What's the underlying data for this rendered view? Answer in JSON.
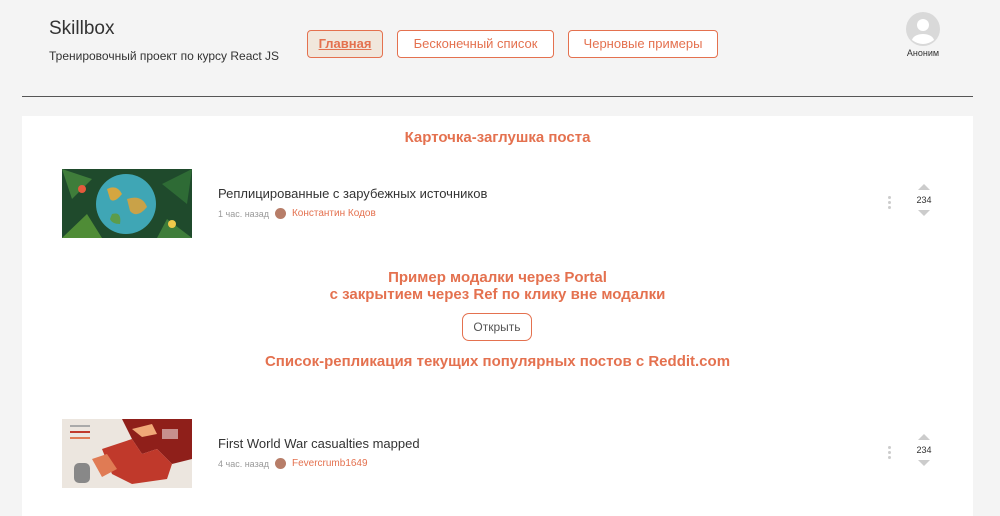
{
  "header": {
    "brand": "Skillbox",
    "subtitle": "Тренировочный проект по курсу React JS",
    "nav": [
      {
        "label": "Главная",
        "active": true
      },
      {
        "label": "Бесконечный список",
        "active": false
      },
      {
        "label": "Черновые примеры",
        "active": false
      }
    ],
    "user": {
      "name": "Аноним"
    }
  },
  "main": {
    "stub_title": "Карточка-заглушка поста",
    "modal_title_line1": "Пример модалки через Portal",
    "modal_title_line2": "с закрытием через Ref по клику вне модалки",
    "open_button": "Открыть",
    "list_title": "Список-репликация текущих популярных постов с Reddit.com",
    "posts": [
      {
        "title": "Реплицированные с зарубежных источников",
        "time": "1 час. назад",
        "author": "Константин Кодов",
        "karma": "234"
      },
      {
        "title": "First World War casualties mapped",
        "time": "4 час. назад",
        "author": "Fevercrumb1649",
        "karma": "234"
      }
    ]
  },
  "colors": {
    "accent": "#e4714f",
    "active_tab_bg": "#f1e7dc"
  }
}
